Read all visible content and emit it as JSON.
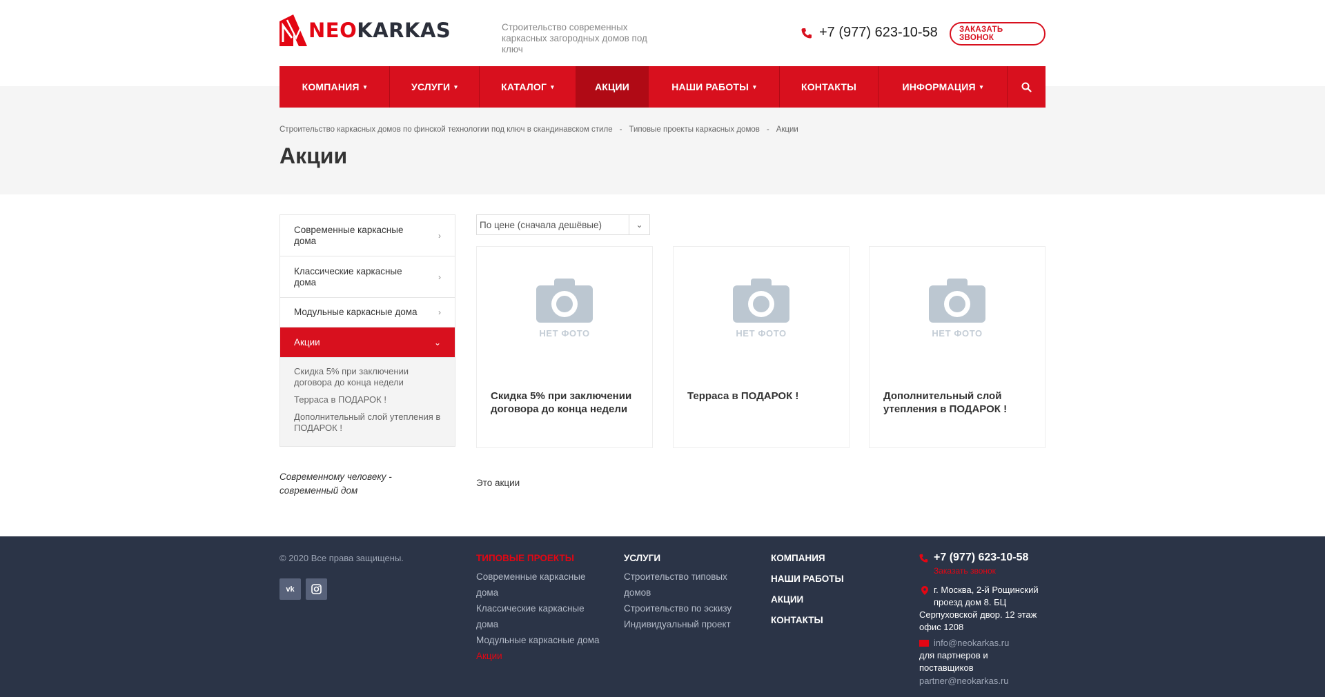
{
  "header": {
    "logo_neo": "NEO",
    "logo_karkas": "KARKAS",
    "tagline": "Строительство современных каркасных загородных домов под ключ",
    "phone": "+7 (977) 623-10-58",
    "callback_label": "ЗАКАЗАТЬ ЗВОНОК"
  },
  "nav": {
    "items": [
      {
        "label": "КОМПАНИЯ",
        "caret": "▾"
      },
      {
        "label": "УСЛУГИ",
        "caret": "▾"
      },
      {
        "label": "КАТАЛОГ",
        "caret": "▾"
      },
      {
        "label": "АКЦИИ"
      },
      {
        "label": "НАШИ РАБОТЫ",
        "caret": "▾"
      },
      {
        "label": "КОНТАКТЫ"
      },
      {
        "label": "ИНФОРМАЦИЯ",
        "caret": "▾"
      }
    ],
    "active": "АКЦИИ"
  },
  "breadcrumb": {
    "items": [
      "Строительство каркасных домов по финской технологии под ключ в скандинавском стиле",
      "Типовые проекты каркасных домов",
      "Акции"
    ],
    "separator": "-"
  },
  "page_title": "Акции",
  "sidebar": {
    "items": [
      {
        "label": "Современные каркасные дома",
        "chevron": "›"
      },
      {
        "label": "Классические каркасные дома",
        "chevron": "›"
      },
      {
        "label": "Модульные каркасные дома",
        "chevron": "›"
      },
      {
        "label": "Акции",
        "chevron": "⌄"
      }
    ],
    "subitems": [
      "Скидка 5% при заключении договора до конца недели",
      "Терраса в ПОДАРОК !",
      "Дополнительный слой утепления в ПОДАРОК !"
    ],
    "slogan": "Современному человеку - современный дом"
  },
  "sort": {
    "value": "По цене (сначала дешёвые)",
    "toggle": "⌄"
  },
  "cards": [
    {
      "no_photo": "НЕТ ФОТО",
      "title": "Скидка 5% при заключении договора до конца недели"
    },
    {
      "no_photo": "НЕТ ФОТО",
      "title": "Терраса в ПОДАРОК !"
    },
    {
      "no_photo": "НЕТ ФОТО",
      "title": "Дополнительный слой утепления в ПОДАРОК !"
    }
  ],
  "description": "Это акции",
  "footer": {
    "copyright": "© 2020 Все права защищены.",
    "social": [
      "vk-icon",
      "instagram-icon"
    ],
    "col_projects": {
      "title": "ТИПОВЫЕ ПРОЕКТЫ",
      "links": [
        "Современные каркасные дома",
        "Классические каркасные дома",
        "Модульные каркасные дома",
        "Акции"
      ]
    },
    "col_services": {
      "title": "УСЛУГИ",
      "links": [
        "Строительство типовых домов",
        "Строительство по эскизу",
        "Индивидуальный проект"
      ]
    },
    "col_main": {
      "links": [
        "КОМПАНИЯ",
        "НАШИ РАБОТЫ",
        "АКЦИИ",
        "КОНТАКТЫ"
      ]
    },
    "contacts": {
      "phone": "+7 (977) 623-10-58",
      "callback": "Заказать звонок",
      "address_line1": "г. Москва, 2-й Рощинский проезд дом 8. БЦ",
      "address_line2": "Серпуховской двор. 12 этаж офис 1208",
      "email": "info@neokarkas.ru",
      "partners_label": "для партнеров и поставщиков",
      "partner_email": "partner@neokarkas.ru"
    }
  },
  "colors": {
    "brand_red": "#d8101e",
    "footer_bg": "#2b3447",
    "band_gray": "#f5f5f5"
  }
}
